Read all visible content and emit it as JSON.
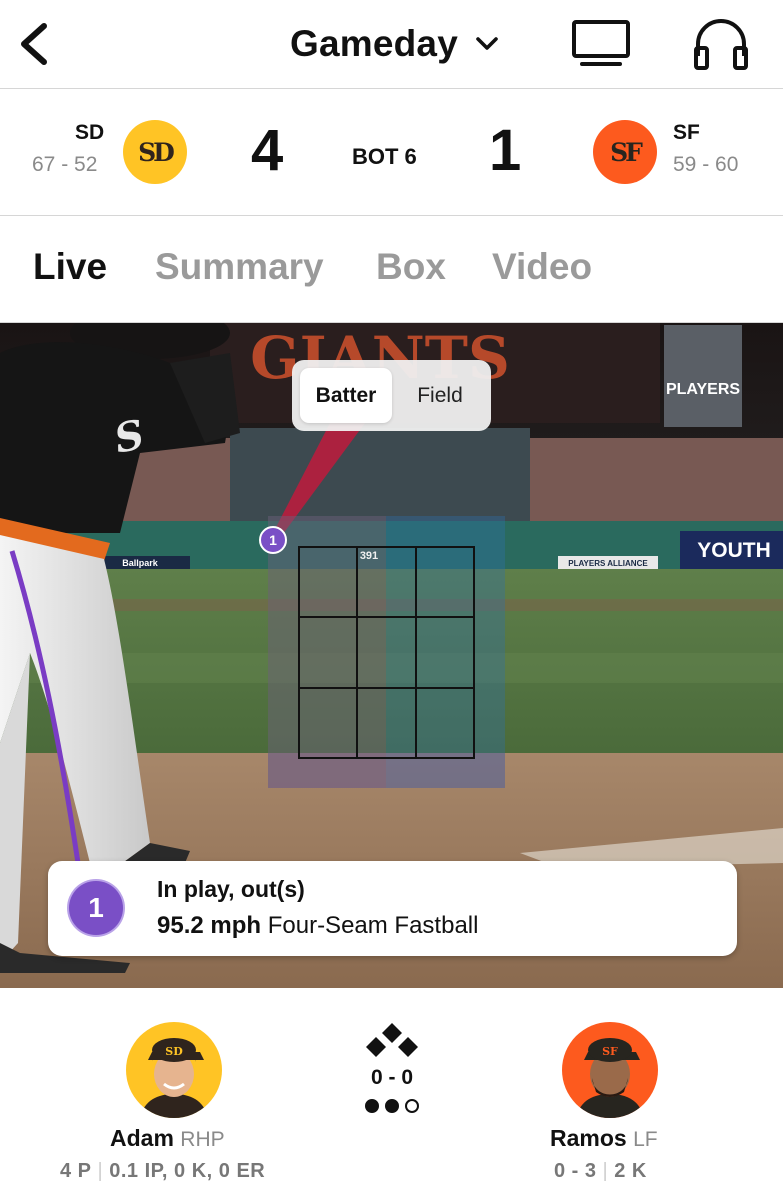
{
  "header": {
    "title": "Gameday",
    "back_icon": "chevron-left-icon",
    "dropdown_icon": "chevron-down-icon",
    "tv_icon": "tv-icon",
    "audio_icon": "headphones-icon"
  },
  "score": {
    "away": {
      "abbr": "SD",
      "record": "67 - 52",
      "runs": "4",
      "logo_text": "SD",
      "logo_color": "#FFC425",
      "logo_text_color": "#2F241D"
    },
    "home": {
      "abbr": "SF",
      "record": "59 - 60",
      "runs": "1",
      "logo_text": "SF",
      "logo_color": "#FD5A1E",
      "logo_text_color": "#27251F"
    },
    "inning": "BOT 6"
  },
  "tabs": [
    {
      "label": "Live",
      "active": true
    },
    {
      "label": "Summary",
      "active": false
    },
    {
      "label": "Box",
      "active": false
    },
    {
      "label": "Video",
      "active": false
    }
  ],
  "view_toggle": {
    "options": [
      "Batter",
      "Field"
    ],
    "selected": "Batter"
  },
  "scene": {
    "scoreboard_sign": "GIANTS",
    "players_sign": "PLAYERS",
    "youth_sign": "YOUTH",
    "distance_marker": "391",
    "ballpark_label": "Ballpark",
    "alliance_label": "PLAYERS ALLIANCE",
    "pitch_marker": "1"
  },
  "pitch": {
    "number": "1",
    "result": "In play, out(s)",
    "speed": "95.2 mph",
    "type": "Four-Seam Fastball",
    "marker_color": "#7A4FC6"
  },
  "matchup": {
    "pitcher": {
      "name": "Adam",
      "position": "RHP",
      "stat1": "4 P",
      "stat2": "0.1 IP, 0 K, 0 ER",
      "bg": "#FFC425"
    },
    "batter": {
      "name": "Ramos",
      "position": "LF",
      "stat1": "0 - 3",
      "stat2": "2 K",
      "bg": "#FD5A1E"
    },
    "count": "0 - 0",
    "outs": 2,
    "outs_max": 3,
    "bases_icon": "bases-diamond-icon"
  }
}
